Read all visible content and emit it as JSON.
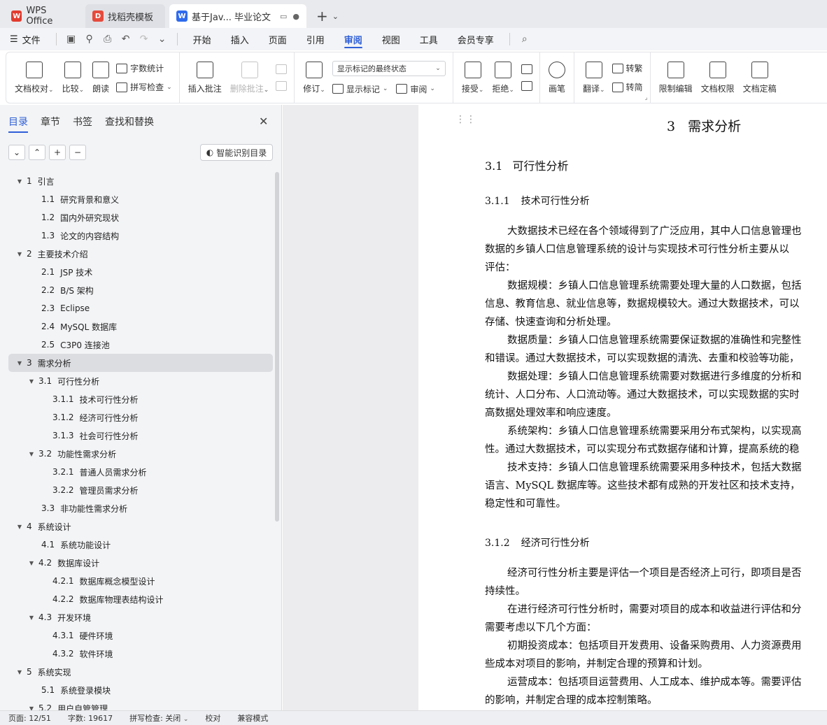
{
  "tabs": [
    {
      "label": "WPS Office",
      "logo": "W"
    },
    {
      "label": "找稻壳模板",
      "logo": "D"
    },
    {
      "label": "基于Jav... 毕业论文",
      "logo": "W"
    }
  ],
  "menu": {
    "file": "文件",
    "items": [
      "开始",
      "插入",
      "页面",
      "引用",
      "审阅",
      "视图",
      "工具",
      "会员专享"
    ],
    "active": "审阅"
  },
  "ribbon": {
    "doc_check": "文档校对",
    "compare": "比较",
    "read_aloud": "朗读",
    "word_count": "字数统计",
    "spell_check": "拼写检查",
    "insert_comment": "插入批注",
    "delete_comment": "删除批注",
    "revise": "修订",
    "markup_state": "显示标记的最终状态",
    "show_markup": "显示标记",
    "review": "审阅",
    "accept": "接受",
    "reject": "拒绝",
    "pen": "画笔",
    "translate": "翻译",
    "to_traditional": "转繁",
    "to_simplified": "转简",
    "restrict_edit": "限制编辑",
    "doc_permission": "文档权限",
    "doc_finalize": "文档定稿"
  },
  "nav": {
    "tabs": [
      "目录",
      "章节",
      "书签",
      "查找和替换"
    ],
    "smart_toc": "智能识别目录",
    "toc": [
      {
        "num": "1",
        "title": "引言",
        "level": 1,
        "expandable": true
      },
      {
        "num": "1.1",
        "title": "研究背景和意义",
        "level": 2,
        "expandable": false
      },
      {
        "num": "1.2",
        "title": "国内外研究现状",
        "level": 2,
        "expandable": false
      },
      {
        "num": "1.3",
        "title": "论文的内容结构",
        "level": 2,
        "expandable": false
      },
      {
        "num": "2",
        "title": "主要技术介绍",
        "level": 1,
        "expandable": true
      },
      {
        "num": "2.1",
        "title": "JSP 技术",
        "level": 2,
        "expandable": false
      },
      {
        "num": "2.2",
        "title": "B/S 架构",
        "level": 2,
        "expandable": false
      },
      {
        "num": "2.3",
        "title": "Eclipse",
        "level": 2,
        "expandable": false
      },
      {
        "num": "2.4",
        "title": "MySQL 数据库",
        "level": 2,
        "expandable": false
      },
      {
        "num": "2.5",
        "title": "C3P0 连接池",
        "level": 2,
        "expandable": false
      },
      {
        "num": "3",
        "title": "需求分析",
        "level": 1,
        "expandable": true,
        "selected": true
      },
      {
        "num": "3.1",
        "title": "可行性分析",
        "level": 2,
        "expandable": true
      },
      {
        "num": "3.1.1",
        "title": "技术可行性分析",
        "level": 3,
        "expandable": false
      },
      {
        "num": "3.1.2",
        "title": "经济可行性分析",
        "level": 3,
        "expandable": false
      },
      {
        "num": "3.1.3",
        "title": "社会可行性分析",
        "level": 3,
        "expandable": false
      },
      {
        "num": "3.2",
        "title": "功能性需求分析",
        "level": 2,
        "expandable": true
      },
      {
        "num": "3.2.1",
        "title": "普通人员需求分析",
        "level": 3,
        "expandable": false
      },
      {
        "num": "3.2.2",
        "title": "管理员需求分析",
        "level": 3,
        "expandable": false
      },
      {
        "num": "3.3",
        "title": "非功能性需求分析",
        "level": 2,
        "expandable": false
      },
      {
        "num": "4",
        "title": "系统设计",
        "level": 1,
        "expandable": true
      },
      {
        "num": "4.1",
        "title": "系统功能设计",
        "level": 2,
        "expandable": false
      },
      {
        "num": "4.2",
        "title": "数据库设计",
        "level": 2,
        "expandable": true
      },
      {
        "num": "4.2.1",
        "title": "数据库概念模型设计",
        "level": 3,
        "expandable": false
      },
      {
        "num": "4.2.2",
        "title": "数据库物理表结构设计",
        "level": 3,
        "expandable": false
      },
      {
        "num": "4.3",
        "title": "开发环境",
        "level": 2,
        "expandable": true
      },
      {
        "num": "4.3.1",
        "title": "硬件环境",
        "level": 3,
        "expandable": false
      },
      {
        "num": "4.3.2",
        "title": "软件环境",
        "level": 3,
        "expandable": false
      },
      {
        "num": "5",
        "title": "系统实现",
        "level": 1,
        "expandable": true
      },
      {
        "num": "5.1",
        "title": "系统登录模块",
        "level": 2,
        "expandable": false
      },
      {
        "num": "5.2",
        "title": "用户自管管理",
        "level": 2,
        "expandable": true
      }
    ]
  },
  "document": {
    "chapter_num": "3",
    "chapter_title": "需求分析",
    "section_num": "3.1",
    "section_title": "可行性分析",
    "sub1_num": "3.1.1",
    "sub1_title": "技术可行性分析",
    "sub1_lines": [
      {
        "text": "大数据技术已经在各个领域得到了广泛应用，其中人口信息管理也",
        "indent": true
      },
      {
        "text": "数据的乡镇人口信息管理系统的设计与实现技术可行性分析主要从以",
        "indent": false
      },
      {
        "text": "评估：",
        "indent": false
      },
      {
        "text": "数据规模：乡镇人口信息管理系统需要处理大量的人口数据，包括",
        "indent": true
      },
      {
        "text": "信息、教育信息、就业信息等，数据规模较大。通过大数据技术，可以",
        "indent": false
      },
      {
        "text": "存储、快速查询和分析处理。",
        "indent": false
      },
      {
        "text": "数据质量：乡镇人口信息管理系统需要保证数据的准确性和完整性",
        "indent": true
      },
      {
        "text": "和错误。通过大数据技术，可以实现数据的清洗、去重和校验等功能，",
        "indent": false
      },
      {
        "text": "数据处理：乡镇人口信息管理系统需要对数据进行多维度的分析和",
        "indent": true
      },
      {
        "text": "统计、人口分布、人口流动等。通过大数据技术，可以实现数据的实时",
        "indent": false
      },
      {
        "text": "高数据处理效率和响应速度。",
        "indent": false
      },
      {
        "text": "系统架构：乡镇人口信息管理系统需要采用分布式架构，以实现高",
        "indent": true
      },
      {
        "text": "性。通过大数据技术，可以实现分布式数据存储和计算，提高系统的稳",
        "indent": false
      },
      {
        "text": "技术支持：乡镇人口信息管理系统需要采用多种技术，包括大数据",
        "indent": true
      },
      {
        "text": "语言、MySQL 数据库等。这些技术都有成熟的开发社区和技术支持，",
        "indent": false
      },
      {
        "text": "稳定性和可靠性。",
        "indent": false
      }
    ],
    "sub2_num": "3.1.2",
    "sub2_title": "经济可行性分析",
    "sub2_lines": [
      {
        "text": "经济可行性分析主要是评估一个项目是否经济上可行，即项目是否",
        "indent": true
      },
      {
        "text": "持续性。",
        "indent": false
      },
      {
        "text": "在进行经济可行性分析时，需要对项目的成本和收益进行评估和分",
        "indent": true
      },
      {
        "text": "需要考虑以下几个方面：",
        "indent": false
      },
      {
        "text": "初期投资成本：包括项目开发费用、设备采购费用、人力资源费用",
        "indent": true
      },
      {
        "text": "些成本对项目的影响，并制定合理的预算和计划。",
        "indent": false
      },
      {
        "text": "运营成本：包括项目运营费用、人工成本、维护成本等。需要评估",
        "indent": true
      },
      {
        "text": "的影响，并制定合理的成本控制策略。",
        "indent": false
      }
    ]
  },
  "status": {
    "page": "页面: 12/51",
    "words": "字数: 19617",
    "spell": "拼写检查: 关闭",
    "proof": "校对",
    "compat": "兼容模式"
  }
}
